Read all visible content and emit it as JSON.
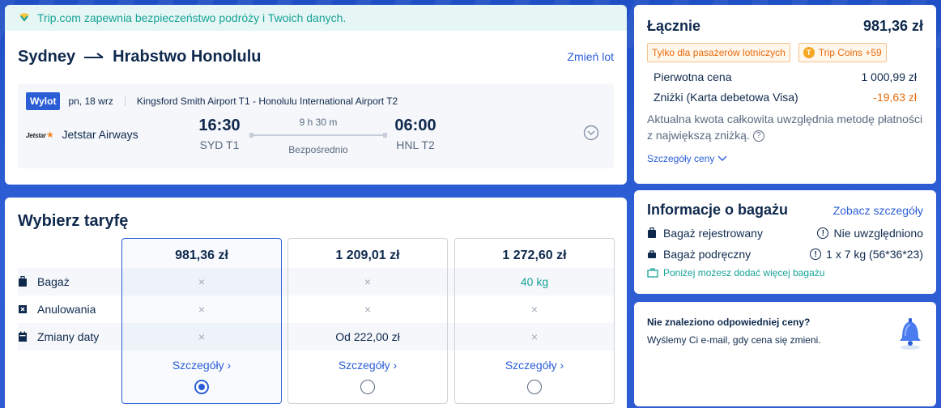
{
  "banner": {
    "text": "Trip.com zapewnia bezpieczeństwo podróży i Twoich danych."
  },
  "flight": {
    "origin": "Sydney",
    "destination": "Hrabstwo Honolulu",
    "change_link": "Zmień lot",
    "segment": {
      "badge": "Wylot",
      "date": "pn, 18 wrz",
      "airports": "Kingsford Smith Airport T1 - Honolulu International Airport T2",
      "airline_logo": "Jetstar",
      "airline": "Jetstar Airways",
      "dep_time": "16:30",
      "dep_code": "SYD T1",
      "duration": "9 h 30 m",
      "stops": "Bezpośrednio",
      "arr_time": "06:00",
      "arr_code": "HNL T2"
    }
  },
  "fares": {
    "title": "Wybierz taryfę",
    "features": [
      "Bagaż",
      "Anulowania",
      "Zmiany daty"
    ],
    "columns": [
      {
        "price": "981,36 zł",
        "bag": "×",
        "cancel": "×",
        "change": "×",
        "details": "Szczegóły",
        "selected": true
      },
      {
        "price": "1 209,01 zł",
        "bag": "×",
        "cancel": "×",
        "change": "Od 222,00 zł",
        "details": "Szczegóły",
        "selected": false
      },
      {
        "price": "1 272,60 zł",
        "bag": "40 kg",
        "cancel": "×",
        "change": "×",
        "details": "Szczegóły",
        "selected": false
      }
    ]
  },
  "summary": {
    "total_label": "Łącznie",
    "total": "981,36 zł",
    "tag_passengers": "Tylko dla pasażerów lotniczych",
    "tag_coins": "Trip Coins +59",
    "original_label": "Pierwotna cena",
    "original_value": "1 000,99 zł",
    "discount_label": "Zniżki (Karta debetowa Visa)",
    "discount_value": "-19,63 zł",
    "note": "Aktualna kwota całkowita uwzględnia metodę płatności z największą zniżką.",
    "details_link": "Szczegóły ceny"
  },
  "baggage": {
    "title": "Informacje o bagażu",
    "link": "Zobacz szczegóły",
    "checked_label": "Bagaż rejestrowany",
    "checked_value": "Nie uwzględniono",
    "carry_label": "Bagaż podręczny",
    "carry_value": "1 x 7 kg (56*36*23)",
    "more": "Poniżej możesz dodać więcej bagażu"
  },
  "alert": {
    "title": "Nie znaleziono odpowiedniej ceny?",
    "text": "Wyślemy Ci e-mail, gdy cena się zmieni."
  },
  "colors": {
    "accent": "#2b5ed6",
    "teal": "#17a398",
    "orange": "#e76d0e",
    "text": "#0f294d"
  }
}
